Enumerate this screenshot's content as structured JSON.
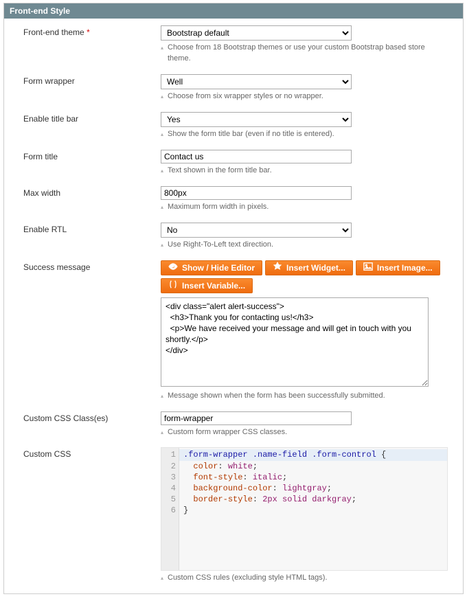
{
  "panel": {
    "title": "Front-end Style"
  },
  "fields": {
    "theme": {
      "label": "Front-end theme",
      "required_marker": "*",
      "value": "Bootstrap default",
      "hint": "Choose from 18 Bootstrap themes or use your custom Bootstrap based store theme."
    },
    "wrapper": {
      "label": "Form wrapper",
      "value": "Well",
      "hint": "Choose from six wrapper styles or no wrapper."
    },
    "titlebar": {
      "label": "Enable title bar",
      "value": "Yes",
      "hint": "Show the form title bar (even if no title is entered)."
    },
    "formtitle": {
      "label": "Form title",
      "value": "Contact us",
      "hint": "Text shown in the form title bar."
    },
    "maxwidth": {
      "label": "Max width",
      "value": "800px",
      "hint": "Maximum form width in pixels."
    },
    "rtl": {
      "label": "Enable RTL",
      "value": "No",
      "hint": "Use Right-To-Left text direction."
    },
    "success": {
      "label": "Success message",
      "buttons": {
        "toggle": "Show / Hide Editor",
        "widget": "Insert Widget...",
        "image": "Insert Image...",
        "variable": "Insert Variable..."
      },
      "value": "<div class=\"alert alert-success\">\n  <h3>Thank you for contacting us!</h3>\n  <p>We have received your message and will get in touch with you shortly.</p>\n</div>",
      "hint": "Message shown when the form has been successfully submitted."
    },
    "cssclass": {
      "label": "Custom CSS Class(es)",
      "value": "form-wrapper",
      "hint": "Custom form wrapper CSS classes."
    },
    "customcss": {
      "label": "Custom CSS",
      "hint": "Custom CSS rules (excluding style HTML tags).",
      "line_numbers": [
        "1",
        "2",
        "3",
        "4",
        "5",
        "6"
      ],
      "code": {
        "l1_sel": ".form-wrapper .name-field .form-control",
        "l1_brace": " {",
        "l2_prop": "color",
        "l2_val": "white",
        "l3_prop": "font-style",
        "l3_val": "italic",
        "l4_prop": "background-color",
        "l4_val": "lightgray",
        "l5_prop": "border-style",
        "l5_val": "2px solid darkgray",
        "l6": "}"
      }
    }
  }
}
